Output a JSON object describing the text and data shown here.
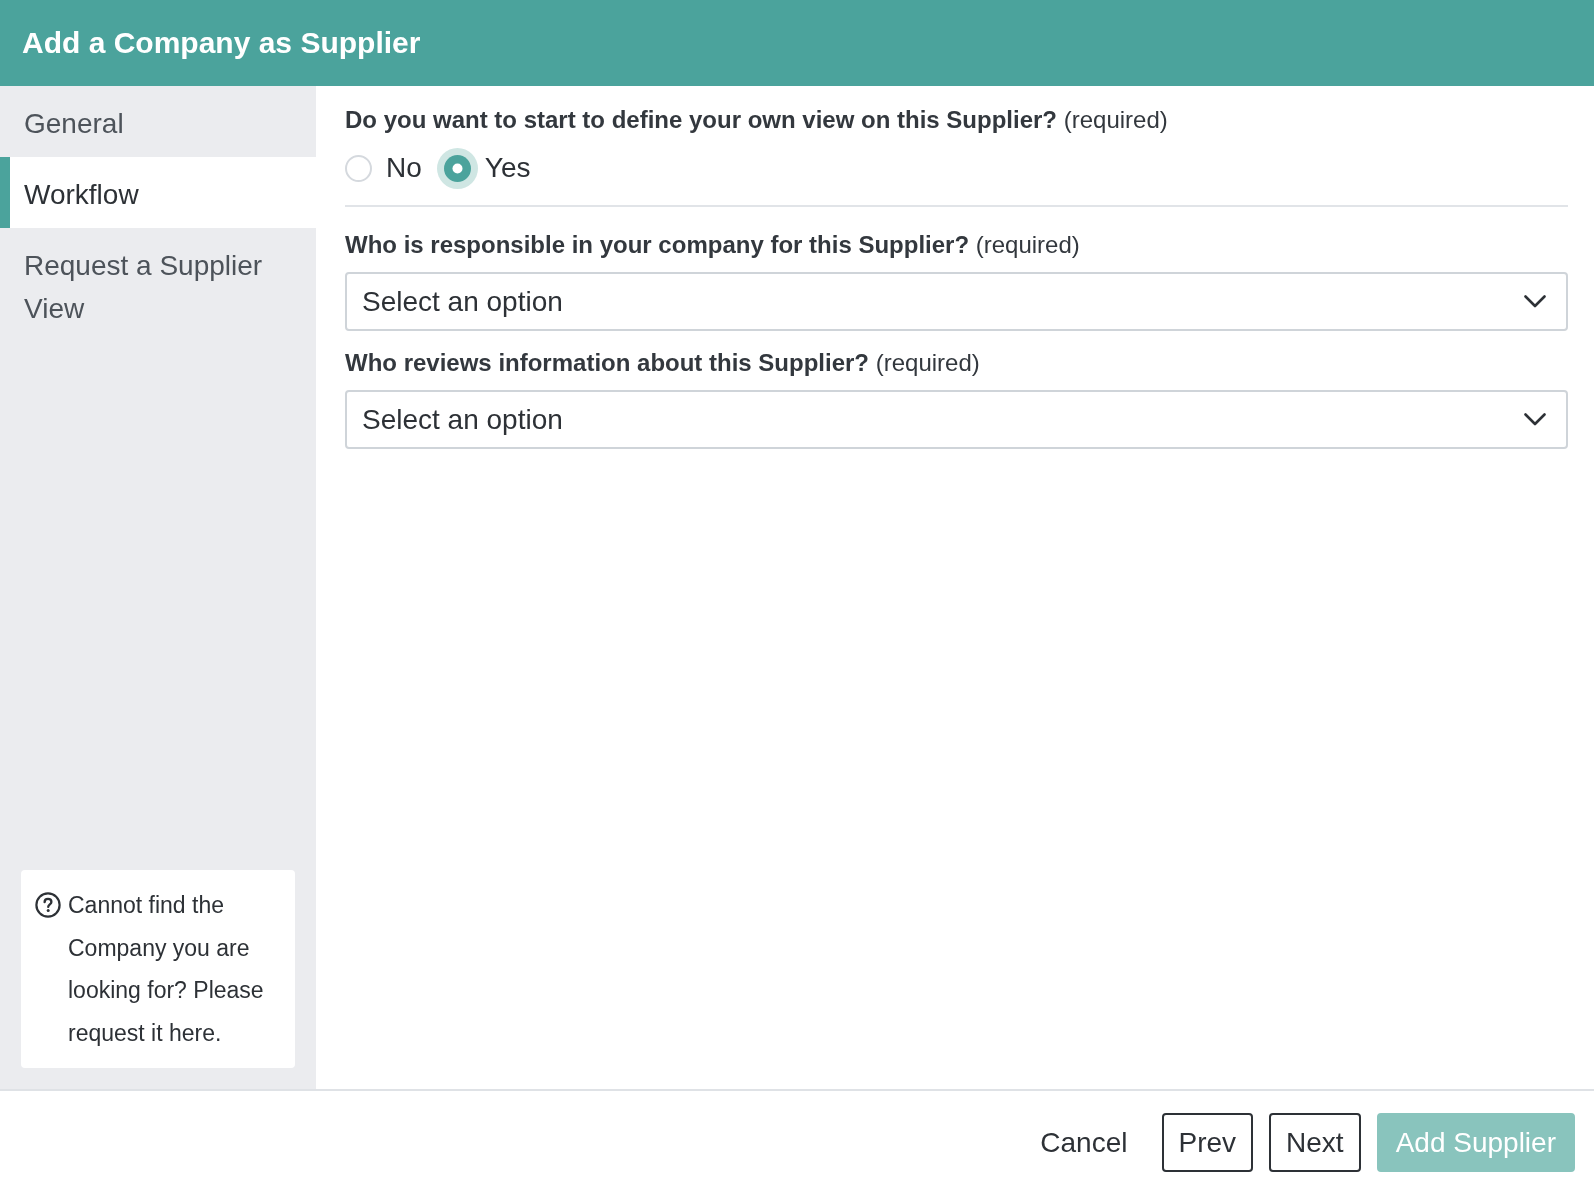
{
  "dialog": {
    "title": "Add a Company as Supplier"
  },
  "sidebar": {
    "items": [
      {
        "label": "General",
        "selected": false
      },
      {
        "label": "Workflow",
        "selected": true
      },
      {
        "label": "Request a Supplier View",
        "selected": false
      }
    ],
    "help_text": "Cannot find the Company you are looking for? Please request it here."
  },
  "form": {
    "questions": [
      {
        "kind": "radio",
        "label": "**Do you want to start to define your own view on this Supplier?** (required)",
        "options": [
          {
            "label": "No",
            "selected": false
          },
          {
            "label": "Yes",
            "selected": true
          }
        ]
      },
      {
        "kind": "select",
        "label": "**Who is responsible in your company for this Supplier?** (required)",
        "placeholder": "Select an option"
      },
      {
        "kind": "select",
        "label": "**Who reviews information about this Supplier?** (required)",
        "placeholder": "Select an option"
      }
    ]
  },
  "footer": {
    "buttons": [
      {
        "kind": "text",
        "label": "Cancel",
        "disabled": false
      },
      {
        "kind": "outline",
        "label": "Prev",
        "disabled": false
      },
      {
        "kind": "outline",
        "label": "Next",
        "disabled": false
      },
      {
        "kind": "primary",
        "label": "Add Supplier",
        "disabled": true
      }
    ]
  }
}
